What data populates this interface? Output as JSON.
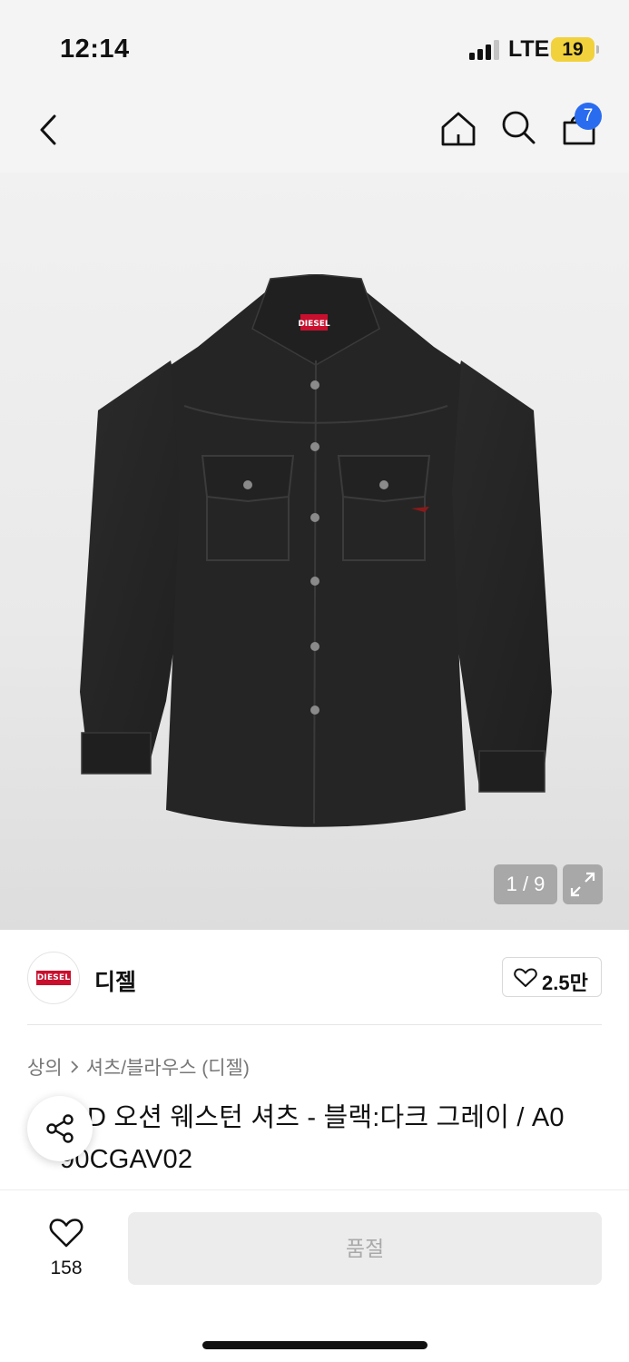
{
  "status_bar": {
    "time": "12:14",
    "network": "LTE",
    "battery": "19",
    "battery_color": "#f2d23c"
  },
  "top_nav": {
    "back_icon": "chevron-left-icon",
    "home_icon": "home-icon",
    "search_icon": "search-icon",
    "cart_icon": "shopping-bag-icon",
    "cart_badge": "7",
    "badge_color": "#2a6cf0"
  },
  "product_image": {
    "counter": "1 / 9",
    "expand_icon": "expand-icon",
    "shirt_logo_label": "DIESEL"
  },
  "brand": {
    "logo_text": "DIESEL",
    "name": "디젤",
    "like_count": "2.5만",
    "brand_color": "#c8102e"
  },
  "breadcrumb": {
    "category": "상의",
    "subcategory": "셔츠/블라우스 (디젤)"
  },
  "product": {
    "title_line_1": "D 오션 웨스턴 셔츠 - 블랙:다크 그레이 / A0",
    "title_line_2": "90CGAV02"
  },
  "share": {
    "icon": "share-icon"
  },
  "bottom_bar": {
    "wish_icon": "heart-icon",
    "wish_count": "158",
    "soldout_label": "품절"
  }
}
